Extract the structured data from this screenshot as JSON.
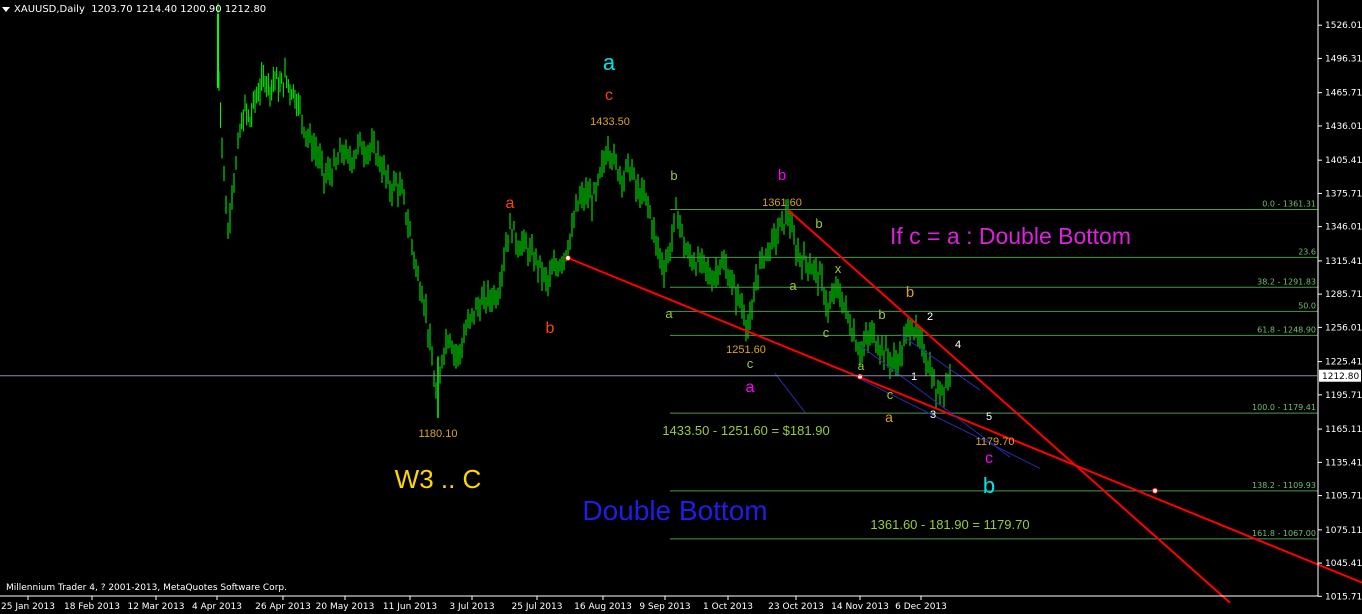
{
  "header": {
    "symbol": "XAUUSD,Daily",
    "ohlc": "1203.70 1214.40 1200.90 1212.80"
  },
  "footer": {
    "copyright": "Millennium Trader 4, ? 2001-2013, MetaQuotes Software Corp."
  },
  "colors": {
    "background": "#000000",
    "bull": "#00ff00",
    "fib": "#4a9a4a",
    "trend": "#ff0000",
    "channel": "#2a2ab0"
  },
  "chart_data": {
    "type": "candlestick",
    "symbol": "XAUUSD",
    "timeframe": "Daily",
    "current_price": "1212.80",
    "ylim": [
      1010,
      1545
    ],
    "price_ticks": [
      "1526.01",
      "1496.31",
      "1465.71",
      "1436.01",
      "1405.41",
      "1375.71",
      "1346.01",
      "1315.41",
      "1285.71",
      "1256.01",
      "1225.41",
      "1195.71",
      "1165.11",
      "1135.41",
      "1105.71",
      "1075.11",
      "1045.41",
      "1015.71"
    ],
    "date_ticks": [
      "25 Jan 2013",
      "18 Feb 2013",
      "12 Mar 2013",
      "4 Apr 2013",
      "26 Apr 2013",
      "20 May 2013",
      "11 Jun 2013",
      "3 Jul 2013",
      "25 Jul 2013",
      "16 Aug 2013",
      "9 Sep 2013",
      "1 Oct 2013",
      "23 Oct 2013",
      "14 Nov 2013",
      "6 Dec 2013"
    ],
    "price_path": [
      [
        218,
        1536
      ],
      [
        219,
        1480
      ],
      [
        222,
        1420
      ],
      [
        228,
        1340
      ],
      [
        232,
        1380
      ],
      [
        236,
        1400
      ],
      [
        240,
        1430
      ],
      [
        245,
        1450
      ],
      [
        250,
        1440
      ],
      [
        255,
        1460
      ],
      [
        260,
        1470
      ],
      [
        265,
        1480
      ],
      [
        270,
        1470
      ],
      [
        275,
        1480
      ],
      [
        280,
        1470
      ],
      [
        285,
        1480
      ],
      [
        290,
        1470
      ],
      [
        295,
        1465
      ],
      [
        300,
        1450
      ],
      [
        306,
        1430
      ],
      [
        312,
        1420
      ],
      [
        318,
        1410
      ],
      [
        324,
        1390
      ],
      [
        330,
        1395
      ],
      [
        336,
        1400
      ],
      [
        342,
        1415
      ],
      [
        348,
        1405
      ],
      [
        354,
        1410
      ],
      [
        360,
        1420
      ],
      [
        366,
        1415
      ],
      [
        372,
        1415
      ],
      [
        378,
        1410
      ],
      [
        384,
        1395
      ],
      [
        390,
        1380
      ],
      [
        396,
        1385
      ],
      [
        402,
        1375
      ],
      [
        408,
        1350
      ],
      [
        414,
        1320
      ],
      [
        418,
        1300
      ],
      [
        422,
        1290
      ],
      [
        426,
        1270
      ],
      [
        430,
        1240
      ],
      [
        434,
        1210
      ],
      [
        438,
        1185
      ],
      [
        442,
        1230
      ],
      [
        446,
        1245
      ],
      [
        450,
        1250
      ],
      [
        454,
        1235
      ],
      [
        458,
        1230
      ],
      [
        462,
        1240
      ],
      [
        466,
        1255
      ],
      [
        470,
        1260
      ],
      [
        474,
        1270
      ],
      [
        478,
        1275
      ],
      [
        482,
        1278
      ],
      [
        486,
        1280
      ],
      [
        490,
        1283
      ],
      [
        494,
        1285
      ],
      [
        498,
        1288
      ],
      [
        504,
        1320
      ],
      [
        508,
        1340
      ],
      [
        512,
        1345
      ],
      [
        516,
        1335
      ],
      [
        520,
        1330
      ],
      [
        524,
        1330
      ],
      [
        528,
        1325
      ],
      [
        532,
        1320
      ],
      [
        536,
        1315
      ],
      [
        540,
        1310
      ],
      [
        544,
        1300
      ],
      [
        548,
        1295
      ],
      [
        552,
        1305
      ],
      [
        556,
        1310
      ],
      [
        560,
        1315
      ],
      [
        564,
        1320
      ],
      [
        568,
        1330
      ],
      [
        572,
        1340
      ],
      [
        576,
        1360
      ],
      [
        580,
        1370
      ],
      [
        584,
        1372
      ],
      [
        588,
        1375
      ],
      [
        592,
        1370
      ],
      [
        596,
        1375
      ],
      [
        600,
        1390
      ],
      [
        604,
        1405
      ],
      [
        608,
        1420
      ],
      [
        612,
        1410
      ],
      [
        616,
        1400
      ],
      [
        620,
        1395
      ],
      [
        624,
        1390
      ],
      [
        628,
        1400
      ],
      [
        632,
        1395
      ],
      [
        636,
        1380
      ],
      [
        640,
        1375
      ],
      [
        644,
        1372
      ],
      [
        648,
        1365
      ],
      [
        652,
        1350
      ],
      [
        656,
        1330
      ],
      [
        660,
        1320
      ],
      [
        664,
        1310
      ],
      [
        668,
        1320
      ],
      [
        672,
        1335
      ],
      [
        676,
        1360
      ],
      [
        680,
        1350
      ],
      [
        684,
        1330
      ],
      [
        688,
        1320
      ],
      [
        692,
        1318
      ],
      [
        696,
        1315
      ],
      [
        700,
        1312
      ],
      [
        704,
        1310
      ],
      [
        708,
        1305
      ],
      [
        712,
        1300
      ],
      [
        716,
        1305
      ],
      [
        720,
        1315
      ],
      [
        724,
        1310
      ],
      [
        728,
        1305
      ],
      [
        732,
        1295
      ],
      [
        736,
        1285
      ],
      [
        740,
        1280
      ],
      [
        744,
        1270
      ],
      [
        748,
        1256
      ],
      [
        752,
        1265
      ],
      [
        756,
        1300
      ],
      [
        760,
        1310
      ],
      [
        764,
        1320
      ],
      [
        768,
        1325
      ],
      [
        772,
        1330
      ],
      [
        776,
        1338
      ],
      [
        780,
        1345
      ],
      [
        784,
        1350
      ],
      [
        788,
        1360
      ],
      [
        792,
        1340
      ],
      [
        796,
        1325
      ],
      [
        800,
        1320
      ],
      [
        804,
        1315
      ],
      [
        808,
        1315
      ],
      [
        812,
        1310
      ],
      [
        816,
        1305
      ],
      [
        820,
        1300
      ],
      [
        824,
        1290
      ],
      [
        828,
        1270
      ],
      [
        832,
        1280
      ],
      [
        836,
        1290
      ],
      [
        840,
        1285
      ],
      [
        844,
        1275
      ],
      [
        848,
        1265
      ],
      [
        852,
        1255
      ],
      [
        856,
        1245
      ],
      [
        860,
        1235
      ],
      [
        864,
        1240
      ],
      [
        868,
        1245
      ],
      [
        872,
        1250
      ],
      [
        876,
        1245
      ],
      [
        880,
        1240
      ],
      [
        884,
        1235
      ],
      [
        888,
        1230
      ],
      [
        892,
        1225
      ],
      [
        896,
        1225
      ],
      [
        900,
        1230
      ],
      [
        904,
        1240
      ],
      [
        908,
        1255
      ],
      [
        912,
        1260
      ],
      [
        916,
        1250
      ],
      [
        920,
        1240
      ],
      [
        924,
        1235
      ],
      [
        928,
        1225
      ],
      [
        932,
        1215
      ],
      [
        936,
        1195
      ],
      [
        940,
        1200
      ],
      [
        944,
        1205
      ],
      [
        948,
        1210
      ],
      [
        952,
        1212.8
      ]
    ],
    "annotations": {
      "wave_labels": [
        {
          "text": "a",
          "color": "#00e5e5"
        },
        {
          "text": "c",
          "color": "#ff4500"
        },
        {
          "text": "a",
          "color": "#ff4500"
        },
        {
          "text": "b",
          "color": "#ff4500"
        },
        {
          "text": "b",
          "color": "#ff00ff"
        },
        {
          "text": "a",
          "color": "#ff00ff"
        },
        {
          "text": "c",
          "color": "#ff00ff"
        },
        {
          "text": "b",
          "color": "#00e5e5"
        },
        {
          "text": "b",
          "color": "#9acd32"
        },
        {
          "text": "a",
          "color": "#9acd32"
        },
        {
          "text": "c",
          "color": "#9acd32"
        },
        {
          "text": "b",
          "color": "#9acd32"
        },
        {
          "text": "x",
          "color": "#9acd32"
        },
        {
          "text": "a",
          "color": "#9acd32"
        },
        {
          "text": "c",
          "color": "#9acd32"
        },
        {
          "text": "b",
          "color": "#9acd32"
        },
        {
          "text": "a",
          "color": "#9acd32"
        },
        {
          "text": "c",
          "color": "#9acd32"
        },
        {
          "text": "b",
          "color": "#daa520"
        },
        {
          "text": "a",
          "color": "#daa520"
        },
        {
          "text": "1",
          "color": "#ffffff"
        },
        {
          "text": "2",
          "color": "#ffffff"
        },
        {
          "text": "3",
          "color": "#ffffff"
        },
        {
          "text": "4",
          "color": "#ffffff"
        },
        {
          "text": "5",
          "color": "#ffffff"
        }
      ],
      "price_labels": [
        {
          "text": "1433.50",
          "color": "#daa520"
        },
        {
          "text": "1361.60",
          "color": "#daa520"
        },
        {
          "text": "1251.60",
          "color": "#daa520"
        },
        {
          "text": "1180.10",
          "color": "#daa520"
        },
        {
          "text": "1179.70",
          "color": "#daa520"
        }
      ],
      "notes": [
        {
          "text": "If   c = a :  Double Bottom",
          "color": "#dd22dd"
        },
        {
          "text": "Double Bottom",
          "color": "#1e1ee8"
        },
        {
          "text": "W3 .. C",
          "color": "#ffd700"
        },
        {
          "text": "1433.50 - 1251.60 = $181.90",
          "color": "#9acd32"
        },
        {
          "text": "1361.60 -  181.90  =  1179.70",
          "color": "#9acd32"
        }
      ]
    },
    "fibonacci": {
      "levels": [
        {
          "label": "0.0 - 1361.31",
          "price": 1361.31
        },
        {
          "label": "23.6",
          "price": 1318.5
        },
        {
          "label": "38.2 - 1291.83",
          "price": 1291.83
        },
        {
          "label": "50.0",
          "price": 1270.3
        },
        {
          "label": "61.8 - 1248.90",
          "price": 1248.9
        },
        {
          "label": "100.0 - 1179.41",
          "price": 1179.41
        },
        {
          "label": "138.2 - 1109.93",
          "price": 1109.93
        },
        {
          "label": "161.8 - 1067.00",
          "price": 1067.0
        }
      ]
    }
  }
}
